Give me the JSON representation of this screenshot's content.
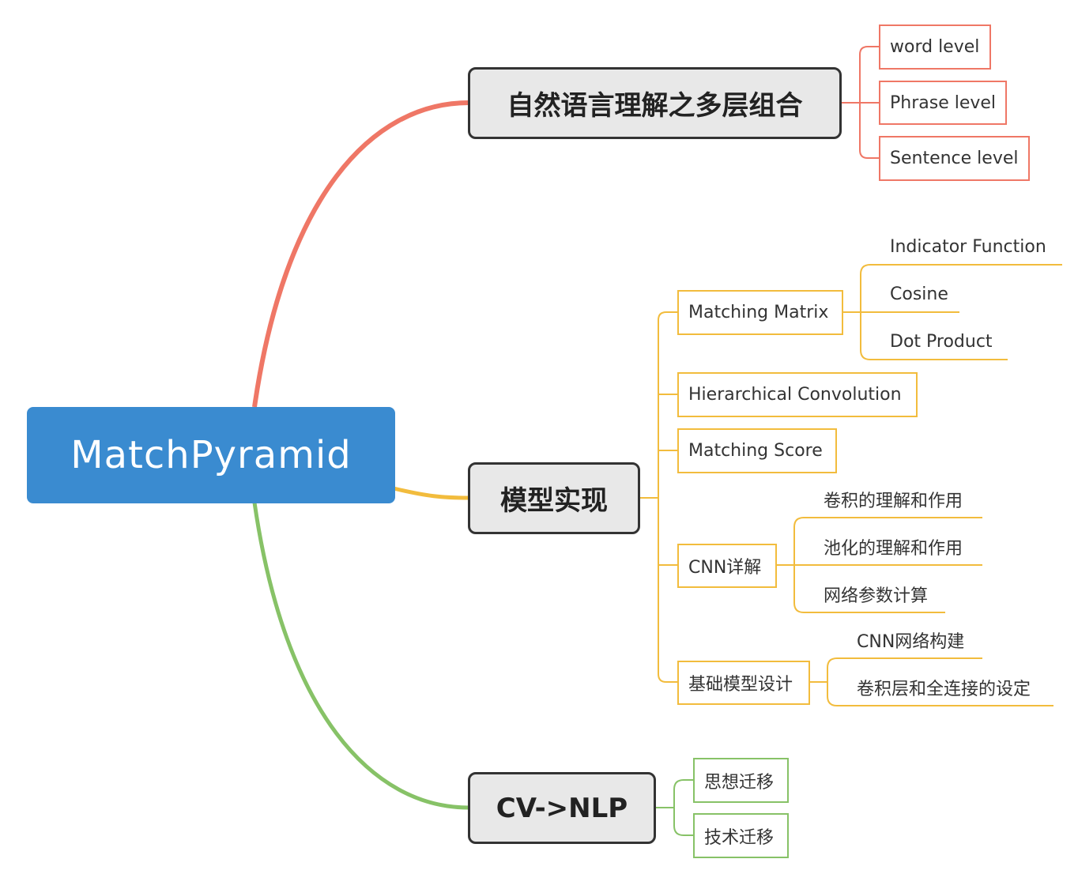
{
  "root": {
    "label": "MatchPyramid"
  },
  "colors": {
    "root": "#3a8bd0",
    "branch1": "#ef7766",
    "branch2": "#f2bc3d",
    "branch3": "#87c267",
    "main_border": "#333333",
    "main_fill": "#e8e8e8"
  },
  "branches": [
    {
      "label": "自然语言理解之多层组合",
      "children": [
        {
          "label": "word level"
        },
        {
          "label": "Phrase level"
        },
        {
          "label": "Sentence level"
        }
      ]
    },
    {
      "label": "模型实现",
      "children": [
        {
          "label": "Matching Matrix",
          "children": [
            {
              "label": "Indicator Function"
            },
            {
              "label": "Cosine"
            },
            {
              "label": "Dot Product"
            }
          ]
        },
        {
          "label": "Hierarchical Convolution"
        },
        {
          "label": "Matching Score"
        },
        {
          "label": "CNN详解",
          "children": [
            {
              "label": "卷积的理解和作用"
            },
            {
              "label": "池化的理解和作用"
            },
            {
              "label": "网络参数计算"
            }
          ]
        },
        {
          "label": "基础模型设计",
          "children": [
            {
              "label": "CNN网络构建"
            },
            {
              "label": "卷积层和全连接的设定"
            }
          ]
        }
      ]
    },
    {
      "label": "CV->NLP",
      "children": [
        {
          "label": "思想迁移"
        },
        {
          "label": "技术迁移"
        }
      ]
    }
  ]
}
